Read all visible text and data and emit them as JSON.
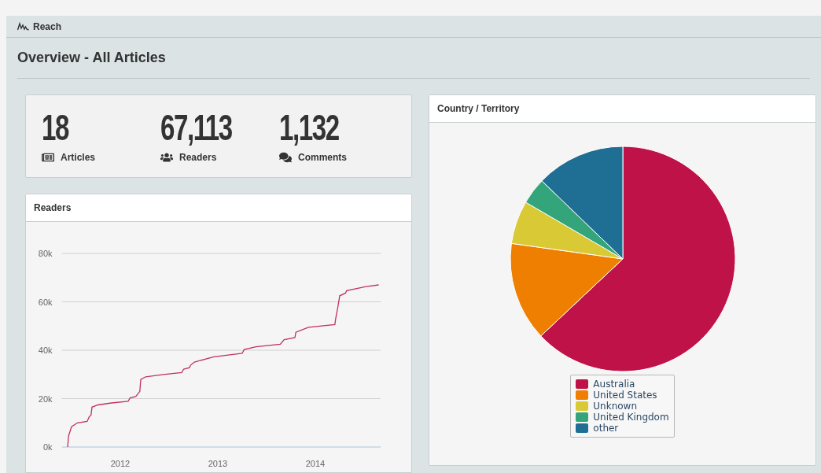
{
  "app": {
    "title": "Reach"
  },
  "page_title": "Overview - All Articles",
  "stats": [
    {
      "kind": "articles",
      "value": "18",
      "label": "Articles"
    },
    {
      "kind": "readers",
      "value": "67,113",
      "label": "Readers"
    },
    {
      "kind": "comments",
      "value": "1,132",
      "label": "Comments"
    }
  ],
  "readers_panel": {
    "title": "Readers",
    "chart_data": {
      "type": "line",
      "x": [
        2011.46,
        2011.47,
        2011.5,
        2011.56,
        2011.66,
        2011.68,
        2011.7,
        2011.71,
        2011.77,
        2011.91,
        2012.08,
        2012.1,
        2012.16,
        2012.2,
        2012.21,
        2012.26,
        2012.44,
        2012.63,
        2012.65,
        2012.71,
        2012.72,
        2012.76,
        2012.96,
        2013.25,
        2013.27,
        2013.39,
        2013.64,
        2013.68,
        2013.79,
        2013.8,
        2013.93,
        2014.2,
        2014.21,
        2014.23,
        2014.25,
        2014.31,
        2014.32,
        2014.52,
        2014.65
      ],
      "grid": true,
      "series": [
        {
          "color": "#c2315f",
          "values": [
            0,
            4700,
            8400,
            10000,
            10600,
            12400,
            13300,
            16500,
            17400,
            18200,
            18900,
            20300,
            20900,
            23000,
            27900,
            29000,
            30000,
            30800,
            32200,
            32800,
            33800,
            35100,
            37300,
            38700,
            40300,
            41400,
            42500,
            44400,
            45200,
            47400,
            49500,
            50600,
            53300,
            57600,
            62500,
            63600,
            64600,
            66300,
            67000
          ]
        }
      ],
      "xlim": [
        2011.4,
        2014.67
      ],
      "ylim": [
        0,
        80000
      ],
      "xticks": [
        {
          "value": 2012,
          "label": "2012"
        },
        {
          "value": 2013,
          "label": "2013"
        },
        {
          "value": 2014,
          "label": "2014"
        }
      ],
      "yticks": [
        {
          "value": 0,
          "label": "0k"
        },
        {
          "value": 20000,
          "label": "20k"
        },
        {
          "value": 40000,
          "label": "40k"
        },
        {
          "value": 60000,
          "label": "60k"
        },
        {
          "value": 80000,
          "label": "80k"
        }
      ]
    }
  },
  "country_panel": {
    "title": "Country / Territory",
    "legend": [
      {
        "label": "Australia",
        "color": "#be1248"
      },
      {
        "label": "United States",
        "color": "#ee7f00"
      },
      {
        "label": "Unknown",
        "color": "#d9c934"
      },
      {
        "label": "United Kingdom",
        "color": "#34a57a"
      },
      {
        "label": "other",
        "color": "#1f6e93"
      }
    ]
  }
}
